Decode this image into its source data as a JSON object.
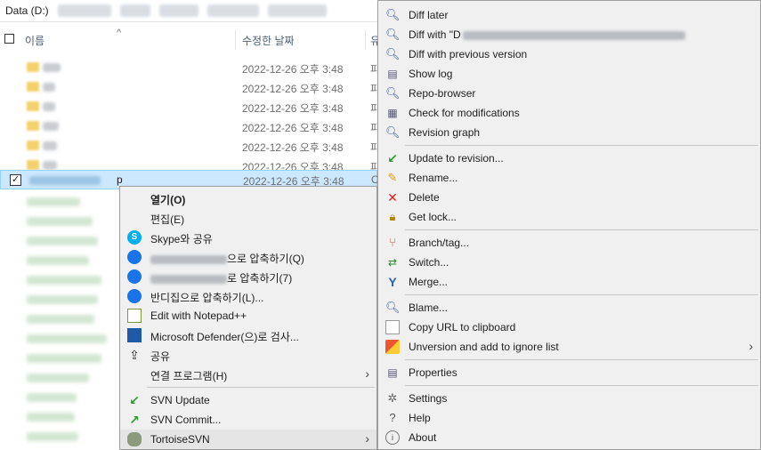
{
  "explorer": {
    "drive_label": "Data (D:)",
    "columns": {
      "name": "이름",
      "date": "수정한 날짜",
      "type_partial": "유"
    },
    "rows": [
      {
        "date": "2022-12-26 오후 3:48",
        "type": "파"
      },
      {
        "date": "2022-12-26 오후 3:48",
        "type": "파"
      },
      {
        "date": "2022-12-26 오후 3:48",
        "type": "파"
      },
      {
        "date": "2022-12-26 오후 3:48",
        "type": "파"
      },
      {
        "date": "2022-12-26 오후 3:48",
        "type": "파"
      },
      {
        "date": "2022-12-26 오후 3:48",
        "type": "파"
      },
      {
        "date": "2022-12-26 오후 3:48",
        "type": "C",
        "selected": true,
        "suffix": "p"
      }
    ]
  },
  "main_menu": {
    "items": [
      {
        "label": "열기(O)"
      },
      {
        "label": "편집(E)"
      },
      {
        "label": "Skype와 공유"
      },
      {
        "label": "으로 압축하기(Q)"
      },
      {
        "label": "로 압축하기(7)"
      },
      {
        "label": "반디집으로 압축하기(L)..."
      },
      {
        "label": "Edit with Notepad++"
      },
      {
        "label": "Microsoft Defender(으)로 검사..."
      },
      {
        "label": "공유"
      },
      {
        "label": "연결 프로그램(H)"
      },
      {
        "label": "SVN Update"
      },
      {
        "label": "SVN Commit..."
      },
      {
        "label": "TortoiseSVN"
      }
    ]
  },
  "svn_menu": {
    "items": [
      {
        "label": "Diff later"
      },
      {
        "label": "Diff with \"D"
      },
      {
        "label": "Diff with previous version"
      },
      {
        "label": "Show log"
      },
      {
        "label": "Repo-browser"
      },
      {
        "label": "Check for modifications"
      },
      {
        "label": "Revision graph"
      },
      {
        "label": "Update to revision..."
      },
      {
        "label": "Rename..."
      },
      {
        "label": "Delete"
      },
      {
        "label": "Get lock..."
      },
      {
        "label": "Branch/tag..."
      },
      {
        "label": "Switch..."
      },
      {
        "label": "Merge..."
      },
      {
        "label": "Blame..."
      },
      {
        "label": "Copy URL to clipboard"
      },
      {
        "label": "Unversion and add to ignore list"
      },
      {
        "label": "Properties"
      },
      {
        "label": "Settings"
      },
      {
        "label": "Help"
      },
      {
        "label": "About"
      }
    ]
  },
  "icons": {
    "arrow_glyph": "›",
    "sort_glyph": "^",
    "check_glyph": "✓"
  }
}
